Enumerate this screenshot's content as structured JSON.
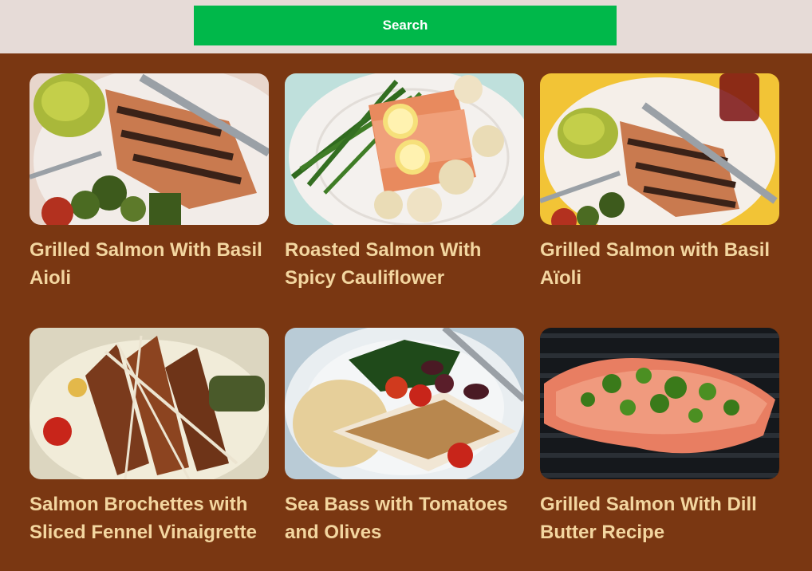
{
  "search": {
    "button_label": "Search"
  },
  "recipes": [
    {
      "title": "Grilled Salmon With Basil Aioli",
      "image": "grilled-salmon-photo"
    },
    {
      "title": "Roasted Salmon With Spicy Cauliflower",
      "image": "roasted-salmon-photo"
    },
    {
      "title": "Grilled Salmon with Basil Aïoli",
      "image": "grilled-salmon-aioli-photo"
    },
    {
      "title": "Salmon Brochettes with Sliced Fennel Vinaigrette",
      "image": "salmon-brochettes-photo"
    },
    {
      "title": "Sea Bass with Tomatoes and Olives",
      "image": "sea-bass-photo"
    },
    {
      "title": "Grilled Salmon With Dill Butter Recipe",
      "image": "dill-salmon-photo"
    }
  ],
  "colors": {
    "page_background": "#7a3712",
    "header_background": "#e6dbd7",
    "search_button": "#00b84a",
    "title_text": "#f3d6a0"
  }
}
